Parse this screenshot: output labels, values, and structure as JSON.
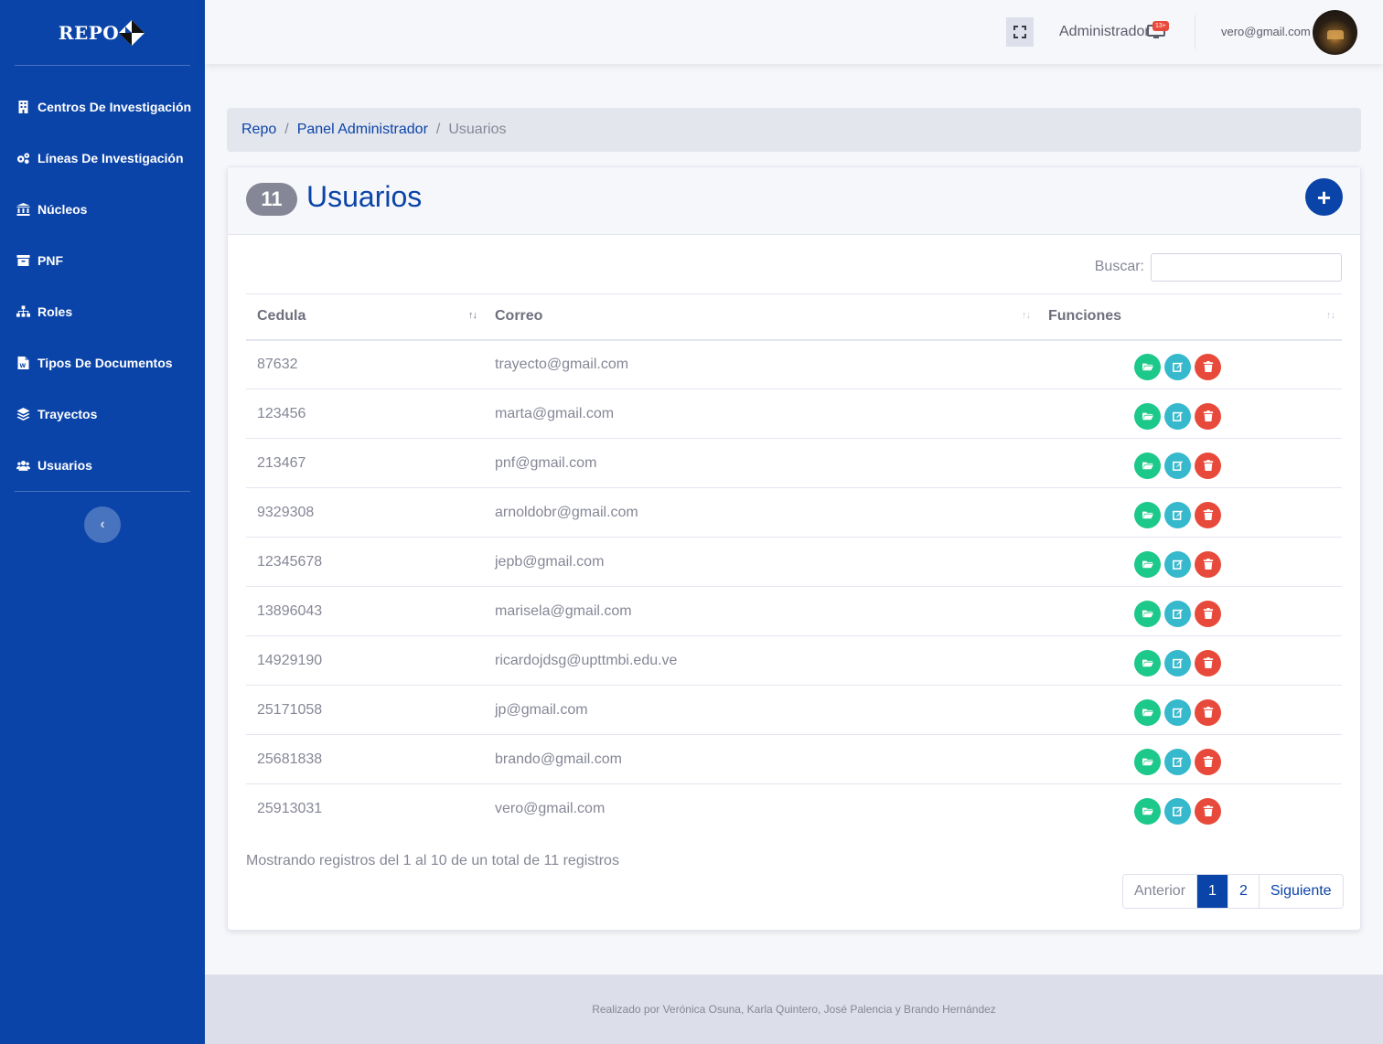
{
  "brand": {
    "name": "REPO"
  },
  "sidebar": {
    "items": [
      {
        "label": "Centros De Investigación",
        "icon": "building-icon"
      },
      {
        "label": "Líneas De Investigación",
        "icon": "cogs-icon"
      },
      {
        "label": "Núcleos",
        "icon": "university-icon"
      },
      {
        "label": "PNF",
        "icon": "archive-icon"
      },
      {
        "label": "Roles",
        "icon": "sitemap-icon"
      },
      {
        "label": "Tipos De Documentos",
        "icon": "file-word-icon"
      },
      {
        "label": "Trayectos",
        "icon": "layer-group-icon"
      },
      {
        "label": "Usuarios",
        "icon": "users-icon"
      }
    ],
    "toggle_icon": "chevron-left-icon"
  },
  "topbar": {
    "admin_label": "Administrador",
    "notification_count": "13+",
    "user_email": "vero@gmail.com"
  },
  "breadcrumb": {
    "items": [
      "Repo",
      "Panel Administrador"
    ],
    "current": "Usuarios",
    "separator": "/"
  },
  "card": {
    "count": "11",
    "title": "Usuarios",
    "add_icon": "+",
    "search_label": "Buscar:",
    "search_value": ""
  },
  "table": {
    "headers": [
      "Cedula",
      "Correo",
      "Funciones"
    ],
    "rows": [
      {
        "cedula": "87632",
        "correo": "trayecto@gmail.com"
      },
      {
        "cedula": "123456",
        "correo": "marta@gmail.com"
      },
      {
        "cedula": "213467",
        "correo": "pnf@gmail.com"
      },
      {
        "cedula": "9329308",
        "correo": "arnoldobr@gmail.com"
      },
      {
        "cedula": "12345678",
        "correo": "jepb@gmail.com"
      },
      {
        "cedula": "13896043",
        "correo": "marisela@gmail.com"
      },
      {
        "cedula": "14929190",
        "correo": "ricardojdsg@upttmbi.edu.ve"
      },
      {
        "cedula": "25171058",
        "correo": "jp@gmail.com"
      },
      {
        "cedula": "25681838",
        "correo": "brando@gmail.com"
      },
      {
        "cedula": "25913031",
        "correo": "vero@gmail.com"
      }
    ],
    "info": "Mostrando registros del 1 al 10 de un total de 11 registros"
  },
  "pagination": {
    "prev": "Anterior",
    "pages": [
      "1",
      "2"
    ],
    "active_page": "1",
    "next": "Siguiente"
  },
  "footer": {
    "text": "Realizado por Verónica Osuna, Karla Quintero, José Palencia y Brando Hernández"
  },
  "colors": {
    "primary": "#0b44a8",
    "success": "#1cc88a",
    "info": "#36b9cc",
    "danger": "#e74a3b"
  }
}
